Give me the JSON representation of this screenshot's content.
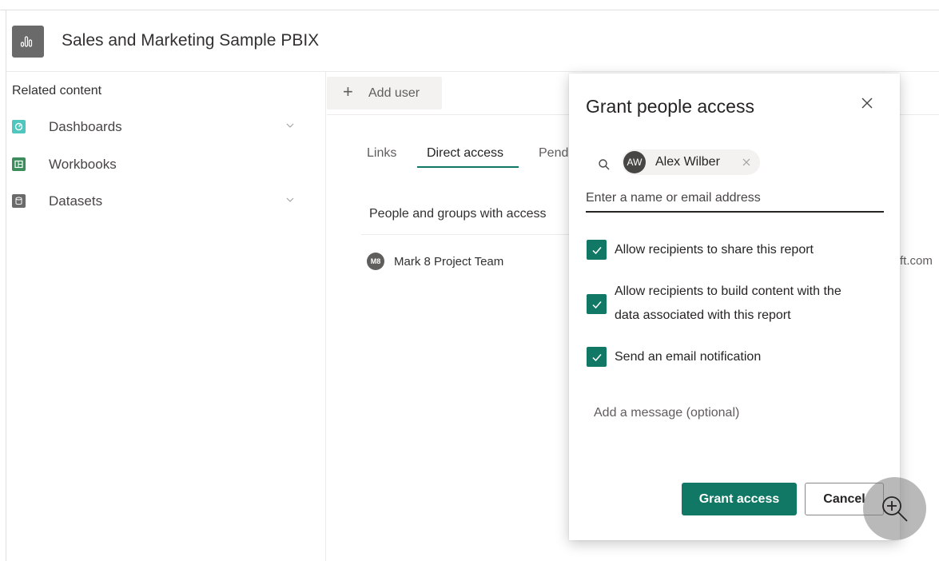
{
  "colors": {
    "accent": "#117865",
    "dashboards_icon": "#4fc7be",
    "workbooks_icon": "#3c8d5c",
    "datasets_icon": "#6b6a6a"
  },
  "header": {
    "icon": "report-icon",
    "title": "Sales and Marketing Sample PBIX"
  },
  "sidebar": {
    "heading": "Related content",
    "items": [
      {
        "label": "Dashboards",
        "icon": "dashboard-icon",
        "expandable": true
      },
      {
        "label": "Workbooks",
        "icon": "excel-workbook-icon",
        "expandable": false
      },
      {
        "label": "Datasets",
        "icon": "dataset-icon",
        "expandable": true
      }
    ]
  },
  "toolbar": {
    "add_user_label": "Add user"
  },
  "tabs": [
    {
      "label": "Links",
      "active": false
    },
    {
      "label": "Direct access",
      "active": true
    },
    {
      "label": "Pend",
      "active": false
    }
  ],
  "access_list": {
    "heading": "People and groups with access",
    "people": [
      {
        "initials": "M8",
        "name": "Mark 8 Project Team"
      }
    ],
    "email_fragment": "ft.com"
  },
  "dialog": {
    "title": "Grant people access",
    "chip": {
      "initials": "AW",
      "name": "Alex Wilber"
    },
    "name_placeholder": "Enter a name or email address",
    "options": [
      {
        "label": "Allow recipients to share this report",
        "checked": true
      },
      {
        "label_line1": "Allow recipients to build content with the",
        "label_line2": "data associated with this report",
        "checked": true
      },
      {
        "label": "Send an email notification",
        "checked": true
      }
    ],
    "message_placeholder": "Add a message (optional)",
    "grant_label": "Grant access",
    "cancel_label": "Cancel"
  }
}
